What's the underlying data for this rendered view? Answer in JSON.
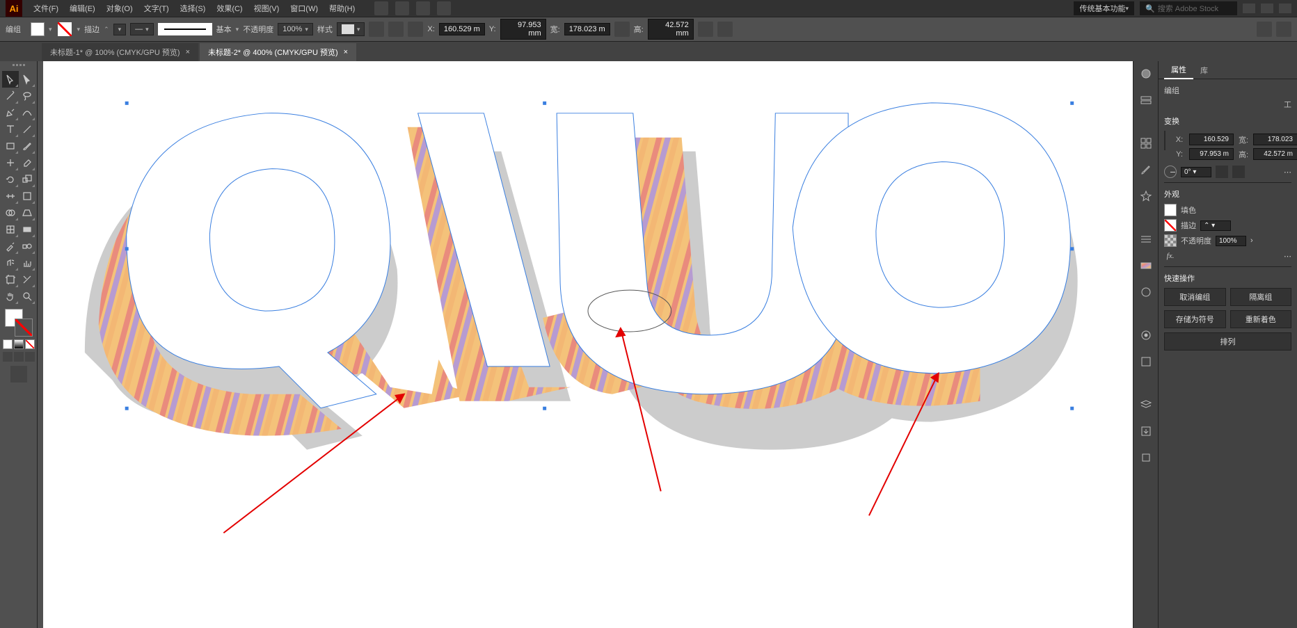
{
  "app_logo": "Ai",
  "menu": {
    "file": "文件(F)",
    "edit": "编辑(E)",
    "object": "对象(O)",
    "type": "文字(T)",
    "select": "选择(S)",
    "effect": "效果(C)",
    "view": "视图(V)",
    "window": "窗口(W)",
    "help": "帮助(H)"
  },
  "workspace": "传统基本功能",
  "search_placeholder": "搜索 Adobe Stock",
  "control": {
    "context": "编组",
    "stroke_label": "描边",
    "brush_label": "基本",
    "opacity_label": "不透明度",
    "opacity_value": "100%",
    "style_label": "样式",
    "x_label": "X:",
    "x_value": "160.529 m",
    "y_label": "Y:",
    "y_value": "97.953 mm",
    "w_label": "宽:",
    "w_value": "178.023 m",
    "h_label": "高:",
    "h_value": "42.572 mm"
  },
  "tabs": [
    {
      "label": "未标题-1* @ 100% (CMYK/GPU 预览)",
      "active": false
    },
    {
      "label": "未标题-2* @ 400% (CMYK/GPU 预览)",
      "active": true
    }
  ],
  "props": {
    "tab1": "属性",
    "tab2": "库",
    "selection_label": "编组",
    "transform_title": "变换",
    "x_lbl": "X:",
    "x_val": "160.529",
    "y_lbl": "Y:",
    "y_val": "97.953 m",
    "w_lbl": "宽:",
    "w_val": "178.023",
    "h_lbl": "高:",
    "h_val": "42.572 m",
    "rotate_lbl": "Δ",
    "rotate_val": "0°",
    "appearance_title": "外观",
    "fill_label": "填色",
    "stroke_label": "描边",
    "opacity_label": "不透明度",
    "opacity_val": "100%",
    "fx": "fx.",
    "quick_title": "快速操作",
    "ungroup": "取消编组",
    "isolate": "隔离组",
    "save_symbol": "存储为符号",
    "recolor": "重新着色",
    "arrange": "排列",
    "more": "工"
  }
}
